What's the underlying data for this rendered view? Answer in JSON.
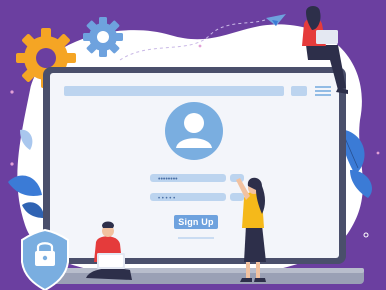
{
  "signup": {
    "label": "Sign Up"
  },
  "password_field": {
    "mask": "••••••••"
  },
  "confirm_field": {
    "mask": "• • • • •"
  },
  "colors": {
    "background": "#6b3fa0",
    "blob": "#ffffff",
    "monitor_frame": "#4a4f6b",
    "screen": "#f3f5fa",
    "accent_blue": "#7aaee0",
    "light_blue": "#bcd4ef",
    "gear_orange": "#f5a524",
    "gear_blue": "#6ea2de",
    "leaf_blue": "#3b7bd6",
    "shield": "#7aaee0"
  },
  "icons": [
    "gear-icon",
    "user-avatar-icon",
    "lock-shield-icon",
    "paper-plane-icon",
    "hamburger-menu-icon"
  ]
}
